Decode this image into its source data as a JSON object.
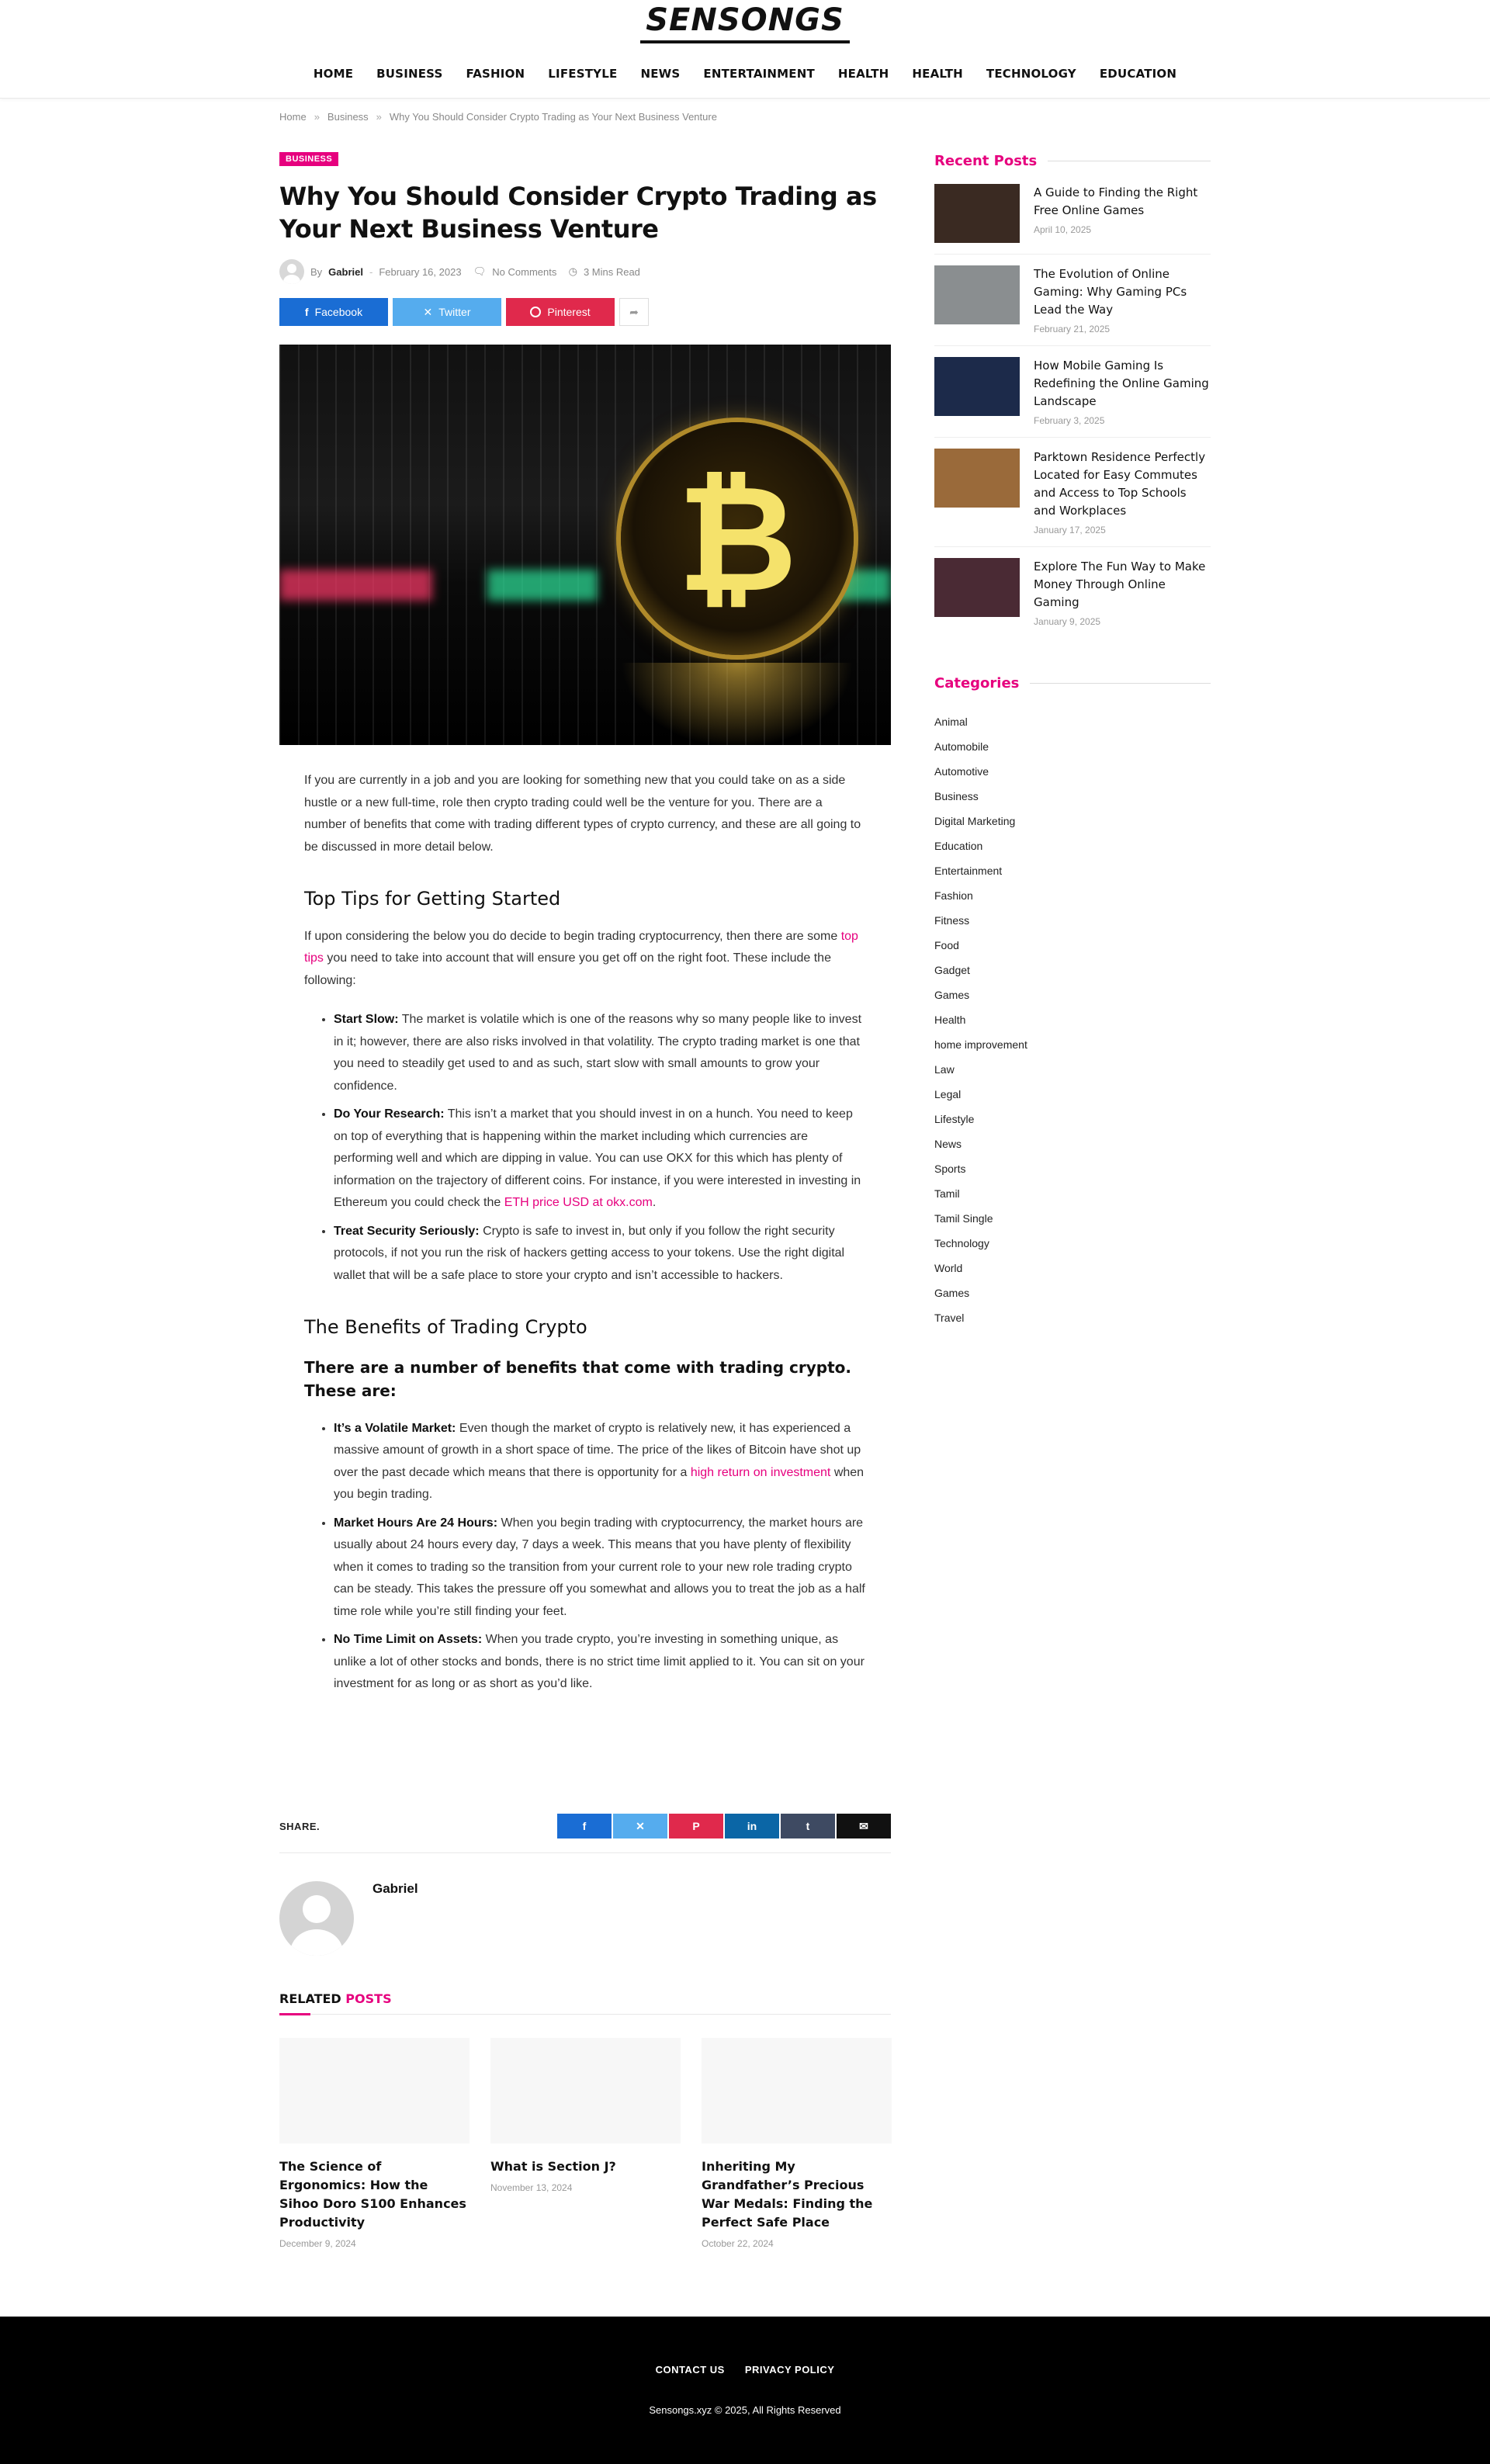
{
  "site": {
    "logo_text": "SENSONGS"
  },
  "nav": [
    "HOME",
    "BUSINESS",
    "FASHION",
    "LIFESTYLE",
    "NEWS",
    "ENTERTAINMENT",
    "HEALTH",
    "HEALTH",
    "TECHNOLOGY",
    "EDUCATION"
  ],
  "breadcrumb": {
    "home": "Home",
    "sep": "»",
    "category": "Business",
    "current": "Why You Should Consider Crypto Trading as Your Next Business Venture"
  },
  "article": {
    "category": "BUSINESS",
    "title": "Why You Should Consider Crypto Trading as Your Next Business Venture",
    "by": "By",
    "author": "Gabriel",
    "date": "February 16, 2023",
    "comments": "No Comments",
    "read_time": "3 Mins Read",
    "share": {
      "facebook": "Facebook",
      "twitter": "Twitter",
      "pinterest": "Pinterest"
    },
    "intro": "If you are currently in a job and you are looking for something new that you could take on as a side hustle or a new full-time, role then crypto trading could well be the venture for you. There are a number of benefits that come with trading different types of crypto currency, and these are all going to be discussed in more detail below.",
    "h_tips": "Top Tips for Getting Started",
    "tips_intro_a": "If upon considering the below you do decide to begin trading cryptocurrency, then there are some ",
    "tips_intro_link": "top tips",
    "tips_intro_b": " you need to take into account that will ensure you get off on the right foot. These include the following:",
    "tips": [
      {
        "label": "Start Slow:",
        "text": " The market is volatile which is one of the reasons why so many people like to invest in it; however, there are also risks involved in that volatility. The crypto trading market is one that you need to steadily get used to and as such, start slow with small amounts to grow your confidence."
      },
      {
        "label": "Do Your Research:",
        "text": " This isn’t a market that you should invest in on a hunch. You need to keep on top of everything that is happening within the market including which currencies are performing well and which are dipping in value. You can use OKX for this which has plenty of information on the trajectory of different coins. For instance, if you were interested in investing in Ethereum you could check the ",
        "link": "ETH price USD at okx.com",
        "after": "."
      },
      {
        "label": "Treat Security Seriously:",
        "text": " Crypto is safe to invest in, but only if you follow the right security protocols, if not you run the risk of hackers getting access to your tokens. Use the right digital wallet that will be a safe place to store your crypto and isn’t accessible to hackers."
      }
    ],
    "h_benefits": "The Benefits of Trading Crypto",
    "h_benefits_sub": "There are a number of benefits that come with trading crypto. These are:",
    "benefits": [
      {
        "label": "It’s a Volatile Market:",
        "text": " Even though the market of crypto is relatively new, it has experienced a massive amount of growth in a short space of time. The price of the likes of Bitcoin have shot up over the past decade which means that there is opportunity for a ",
        "link": "high return on investment",
        "after": " when you begin trading."
      },
      {
        "label": "Market Hours Are 24 Hours:",
        "text": " When you begin trading with cryptocurrency, the market hours are usually about 24 hours every day, 7 days a week. This means that you have plenty of flexibility when it comes to trading so the transition from your current role to your new role trading crypto can be steady. This takes the pressure off you somewhat and allows you to treat the job as a half time role while you’re still finding your feet."
      },
      {
        "label": "No Time Limit on Assets:",
        "text": " When you trade crypto, you’re investing in something unique, as unlike a lot of other stocks and bonds, there is no strict time limit applied to it. You can sit on your investment for as long or as short as you’d like."
      }
    ],
    "share_label": "SHARE."
  },
  "author_box": {
    "name": "Gabriel"
  },
  "related": {
    "title_a": "RELATED",
    "title_b": "POSTS",
    "posts": [
      {
        "title": "The Science of Ergonomics: How the Sihoo Doro S100 Enhances Productivity",
        "date": "December 9, 2024"
      },
      {
        "title": "What is Section J?",
        "date": "November 13, 2024"
      },
      {
        "title": "Inheriting My Grandfather’s Precious War Medals: Finding the Perfect Safe Place",
        "date": "October 22, 2024"
      }
    ]
  },
  "sidebar": {
    "recent_title": "Recent Posts",
    "recent": [
      {
        "title": "A Guide to Finding the Right Free Online Games",
        "date": "April 10, 2025",
        "thumb": "#3a2a22"
      },
      {
        "title": "The Evolution of Online Gaming: Why Gaming PCs Lead the Way",
        "date": "February 21, 2025",
        "thumb": "#8a8e90"
      },
      {
        "title": "How Mobile Gaming Is Redefining the Online Gaming Landscape",
        "date": "February 3, 2025",
        "thumb": "#1c2a4a"
      },
      {
        "title": "Parktown Residence Perfectly Located for Easy Commutes and Access to Top Schools and Workplaces",
        "date": "January 17, 2025",
        "thumb": "#9a6a3a"
      },
      {
        "title": "Explore The Fun Way to Make Money Through Online Gaming",
        "date": "January 9, 2025",
        "thumb": "#4a2a34"
      }
    ],
    "categories_title": "Categories",
    "categories": [
      "Animal",
      "Automobile",
      "Automotive",
      "Business",
      "Digital Marketing",
      "Education",
      "Entertainment",
      "Fashion",
      "Fitness",
      "Food",
      "Gadget",
      "Games",
      "Health",
      "home improvement",
      "Law",
      "Legal",
      "Lifestyle",
      "News",
      "Sports",
      "Tamil",
      "Tamil Single",
      "Technology",
      "World",
      "Games",
      "Travel"
    ]
  },
  "footer": {
    "links": [
      "CONTACT US",
      "PRIVACY POLICY"
    ],
    "copyright": "Sensongs.xyz © 2025, All Rights Reserved"
  },
  "colors": {
    "accent": "#e6007e",
    "facebook": "#1a6dd4",
    "twitter": "#55acee",
    "pinterest": "#e0294c",
    "linkedin": "#0b66a6",
    "tumblr": "#3e4a62"
  }
}
